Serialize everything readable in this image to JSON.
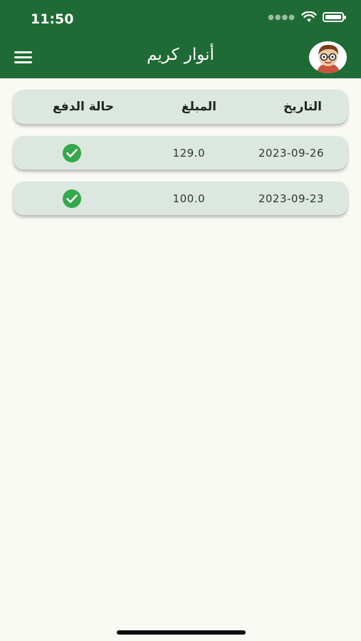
{
  "status_bar": {
    "time": "11:50"
  },
  "header": {
    "title": "أنوار كريم"
  },
  "table": {
    "columns": {
      "date": "التاريخ",
      "amount": "المبلغ",
      "status": "حالة الدفع"
    },
    "rows": [
      {
        "date": "2023-09-26",
        "amount": "129.0",
        "status": "paid"
      },
      {
        "date": "2023-09-23",
        "amount": "100.0",
        "status": "paid"
      }
    ]
  },
  "colors": {
    "header_bg": "#1f6b35",
    "card_bg": "#dce8df",
    "page_bg": "#fafaf5",
    "check": "#34a84a"
  },
  "icons": [
    "menu-icon",
    "wifi-icon",
    "battery-icon",
    "avatar",
    "check-circle-icon"
  ]
}
